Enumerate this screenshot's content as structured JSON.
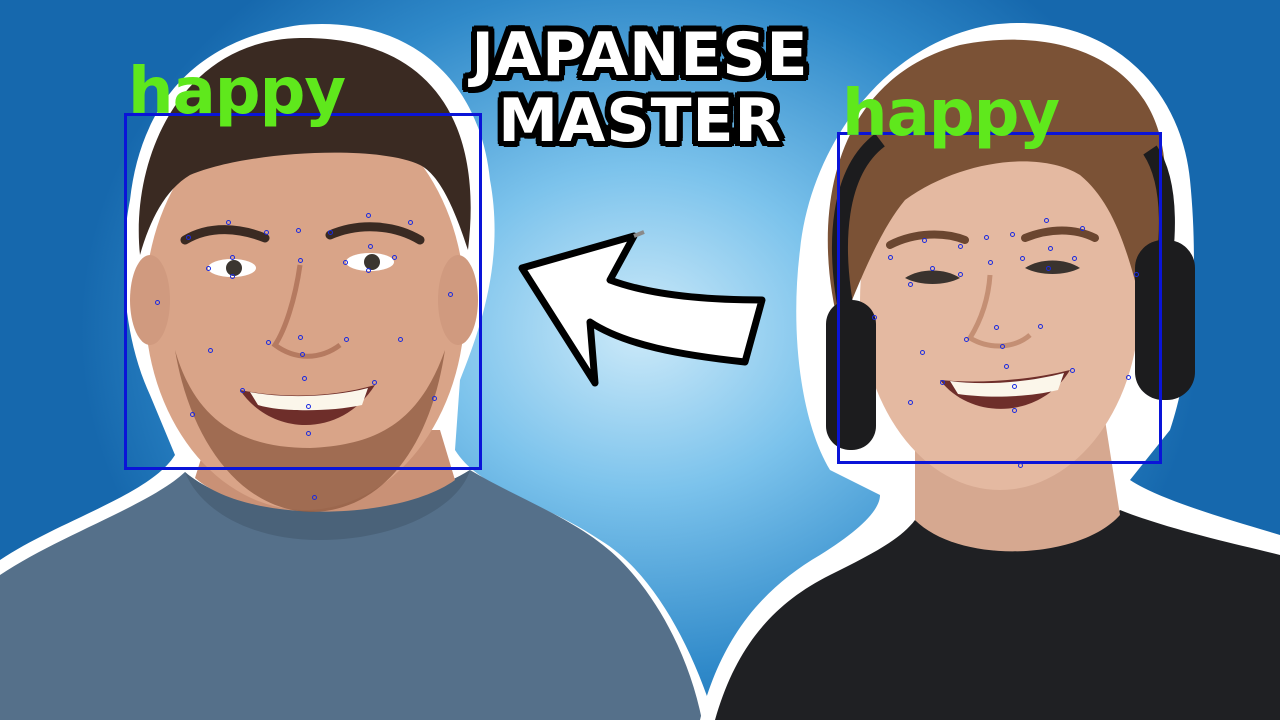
{
  "thumbnail": {
    "title_lines": [
      "JAPANESE",
      "MASTER"
    ],
    "left_person": {
      "emotion_label": "happy"
    },
    "right_person": {
      "emotion_label": "happy"
    }
  },
  "colors": {
    "emotion_label": "#5fe81c",
    "face_box": "#0a14d8",
    "background": "#2f89c9",
    "title_text": "#ffffff",
    "title_outline": "#000000"
  },
  "icons": {
    "arrow": "curved-arrow-left-icon"
  }
}
